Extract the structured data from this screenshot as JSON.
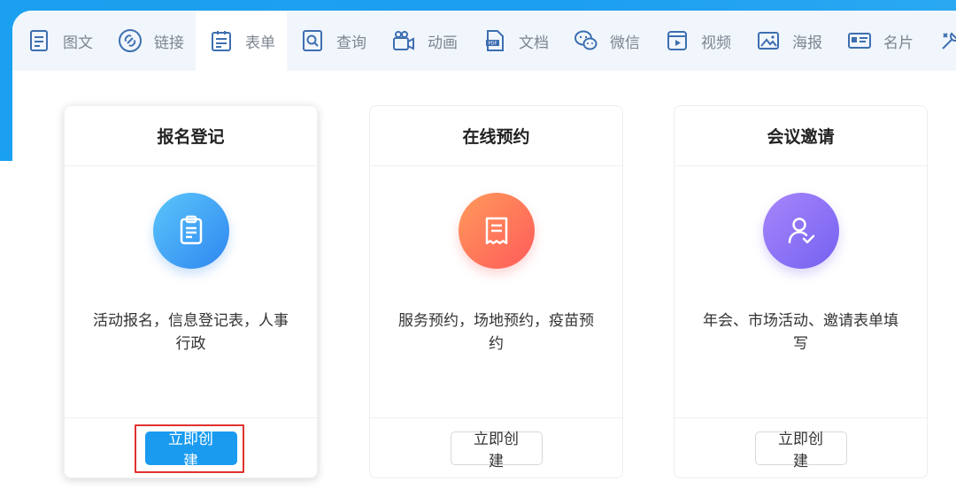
{
  "tabs": [
    {
      "label": "图文",
      "icon": "doc-text-icon",
      "active": false
    },
    {
      "label": "链接",
      "icon": "link-icon",
      "active": false
    },
    {
      "label": "表单",
      "icon": "form-icon",
      "active": true
    },
    {
      "label": "查询",
      "icon": "search-doc-icon",
      "active": false
    },
    {
      "label": "动画",
      "icon": "video-camera-icon",
      "active": false
    },
    {
      "label": "文档",
      "icon": "pdf-icon",
      "active": false
    },
    {
      "label": "微信",
      "icon": "wechat-icon",
      "active": false
    },
    {
      "label": "视频",
      "icon": "video-play-icon",
      "active": false
    },
    {
      "label": "海报",
      "icon": "image-icon",
      "active": false
    },
    {
      "label": "名片",
      "icon": "business-card-icon",
      "active": false
    }
  ],
  "cards": [
    {
      "title": "报名登记",
      "desc_line1": "活动报名，信息登记表，人事",
      "desc_line2": "行政",
      "button": "立即创建",
      "icon": "clipboard-icon",
      "color": "#2f86f0"
    },
    {
      "title": "在线预约",
      "desc_line1": "服务预约，场地预约，疫苗预",
      "desc_line2": "约",
      "button": "立即创建",
      "icon": "receipt-icon",
      "color": "#ff5b5b"
    },
    {
      "title": "会议邀请",
      "desc_line1": "年会、市场活动、邀请表单填",
      "desc_line2": "写",
      "button": "立即创建",
      "icon": "user-check-icon",
      "color": "#7561f0"
    }
  ],
  "colors": {
    "brand_blue": "#1a9bf0",
    "highlight_red": "#e0322f",
    "tab_text": "#7d8590"
  }
}
